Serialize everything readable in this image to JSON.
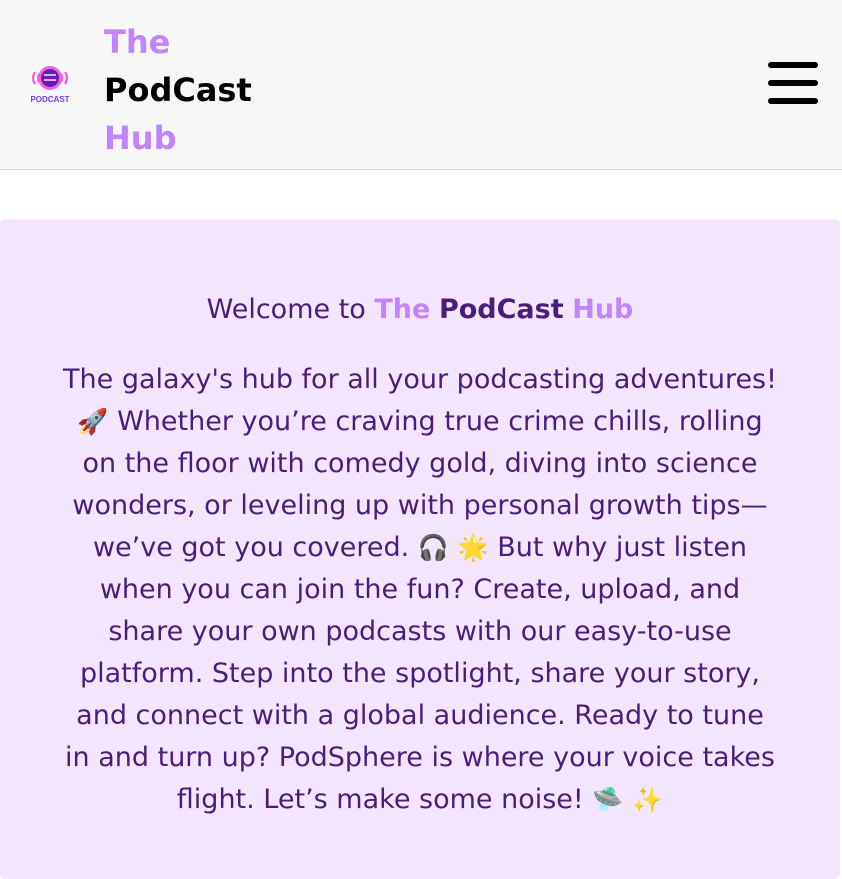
{
  "navbar": {
    "logo": {
      "icon": "podcast-mic-logo",
      "text": "PODCAST"
    },
    "brand": {
      "line1": "The",
      "line2": "PodCast",
      "line3": "Hub"
    },
    "menu_icon": "hamburger-menu-icon"
  },
  "hero": {
    "title_prefix": "Welcome to ",
    "title_the": "The",
    "title_podcast": "PodCast",
    "title_hub": "Hub",
    "body": [
      {
        "type": "text",
        "value": "The galaxy's hub for all your podcasting adventures! "
      },
      {
        "type": "emoji",
        "value": "🚀",
        "name": "rocket-icon"
      },
      {
        "type": "text",
        "value": " Whether you’re craving true crime chills, rolling on the floor with comedy gold, diving into science wonders, or leveling up with personal growth tips—we’ve got you covered. "
      },
      {
        "type": "emoji",
        "value": "🎧",
        "name": "headphones-icon"
      },
      {
        "type": "text",
        "value": " "
      },
      {
        "type": "emoji",
        "value": "🌟",
        "name": "star-icon"
      },
      {
        "type": "text",
        "value": " But why just listen when you can join the fun? Create, upload, and share your own podcasts with our easy-to-use platform. Step into the spotlight, share your story, and connect with a global audience. Ready to tune in and turn up? PodSphere is where your voice takes flight. Let’s make some noise! "
      },
      {
        "type": "emoji",
        "value": "🛸",
        "name": "ufo-icon"
      },
      {
        "type": "text",
        "value": " "
      },
      {
        "type": "emoji",
        "value": "✨",
        "name": "sparkles-icon"
      }
    ]
  },
  "colors": {
    "accent": "#c084fc",
    "text": "#4a1d7a",
    "hero_background": "#f3e5fd",
    "navbar_background": "#f7f7f8"
  }
}
